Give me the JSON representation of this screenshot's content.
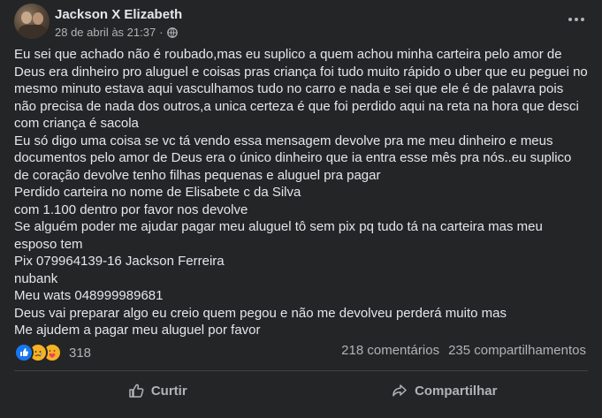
{
  "post": {
    "author": "Jackson X Elizabeth",
    "timestamp": "28 de abril às 21:37",
    "separator": "·",
    "paragraphs": [
      "Eu sei que achado não é roubado,mas eu suplico a quem achou minha carteira pelo amor de Deus era dinheiro pro aluguel e coisas pras criança foi tudo muito rápido o uber que eu peguei no mesmo minuto estava aqui vasculhamos tudo no carro e nada e sei que ele é de palavra pois não precisa de nada dos outros,a unica certeza é que foi perdido aqui na reta  na hora que desci com criança é sacola",
      "Eu só digo uma coisa se vc tá vendo essa mensagem devolve pra me meu dinheiro e meus documentos pelo amor de Deus era o único dinheiro que ia entra esse mês pra nós..eu suplico de coração devolve tenho filhas pequenas e aluguel pra pagar",
      "Perdido carteira no nome de Elisabete c da Silva",
      "com 1.100 dentro por favor nos devolve",
      "Se alguém poder me ajudar pagar meu aluguel tô sem pix pq tudo tá na carteira mas meu esposo tem",
      "Pix 079964139-16 Jackson Ferreira",
      "nubank",
      "Meu wats 048999989681",
      "Deus vai preparar algo eu creio quem pegou e não me devolveu perderá muito mas",
      "Me ajudem a pagar meu aluguel por favor"
    ]
  },
  "stats": {
    "reactions_count": "318",
    "comments": "218 comentários",
    "shares": "235 compartilhamentos",
    "reaction_icons": [
      "like-icon",
      "sad-icon",
      "care-icon"
    ]
  },
  "actions": {
    "like_label": "Curtir",
    "share_label": "Compartilhar"
  },
  "colors": {
    "background": "#242526",
    "text": "#e4e6eb",
    "secondary_text": "#b0b3b8",
    "like_blue": "#1877f2",
    "emoji_yellow": "#f7b125"
  }
}
